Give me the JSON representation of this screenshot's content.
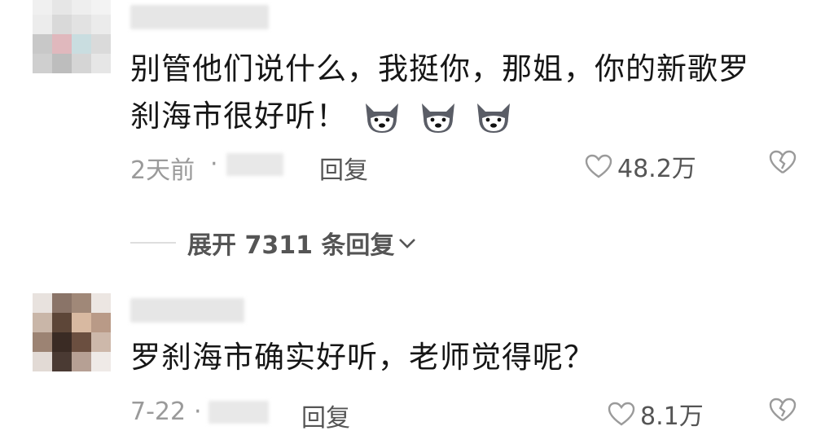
{
  "comments": [
    {
      "text_line1": "别管他们说什么，我挺你，那姐，你的新歌罗",
      "text_line2": "刹海市很好听！",
      "emoji_icon": "husky-dog-emoji",
      "time": "2天前",
      "separator": "·",
      "reply_label": "回复",
      "likes": "48.2万",
      "expand_label": "展开 7311 条回复"
    },
    {
      "text": "罗刹海市确实好听，老师觉得呢？",
      "time": "7-22",
      "separator": "·",
      "reply_label": "回复",
      "likes": "8.1万"
    }
  ],
  "icons": {
    "like": "heart-outline-icon",
    "dislike": "broken-heart-icon",
    "expand": "chevron-down-icon"
  },
  "colors": {
    "text": "#161616",
    "meta": "#9a9a9a",
    "action": "#555555"
  }
}
